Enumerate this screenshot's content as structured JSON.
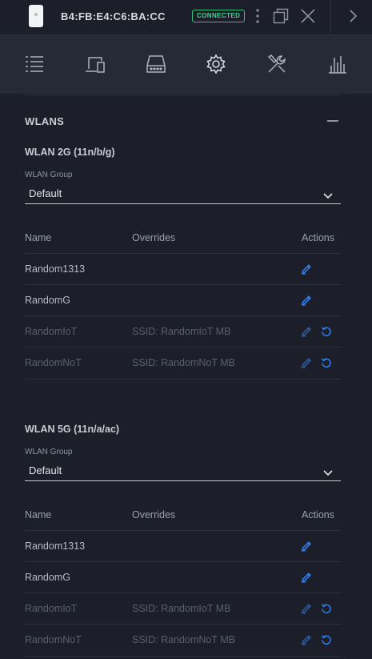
{
  "header": {
    "device_mac": "B4:FB:E4:C6:BA:CC",
    "status_badge": "CONNECTED",
    "status_color": "#32c27a"
  },
  "toolbar": {
    "tabs": [
      {
        "icon": "list-icon"
      },
      {
        "icon": "devices-icon"
      },
      {
        "icon": "storage-icon"
      },
      {
        "icon": "gear-icon"
      },
      {
        "icon": "tools-icon"
      },
      {
        "icon": "stats-icon"
      }
    ]
  },
  "section": {
    "title": "WLANS"
  },
  "bands": [
    {
      "title": "WLAN 2G (11n/b/g)",
      "group_label": "WLAN Group",
      "group_value": "Default",
      "columns": [
        "Name",
        "Overrides",
        "Actions"
      ],
      "rows": [
        {
          "name": "Random1313",
          "overrides": "",
          "enabled": true
        },
        {
          "name": "RandomG",
          "overrides": "",
          "enabled": true
        },
        {
          "name": "RandomIoT",
          "overrides": "SSID: RandomIoT MB",
          "enabled": false
        },
        {
          "name": "RandomNoT",
          "overrides": "SSID: RandomNoT MB",
          "enabled": false
        }
      ]
    },
    {
      "title": "WLAN 5G (11n/a/ac)",
      "group_label": "WLAN Group",
      "group_value": "Default",
      "columns": [
        "Name",
        "Overrides",
        "Actions"
      ],
      "rows": [
        {
          "name": "Random1313",
          "overrides": "",
          "enabled": true
        },
        {
          "name": "RandomG",
          "overrides": "",
          "enabled": true
        },
        {
          "name": "RandomIoT",
          "overrides": "SSID: RandomIoT MB",
          "enabled": false
        },
        {
          "name": "RandomNoT",
          "overrides": "SSID: RandomNoT MB",
          "enabled": false
        }
      ]
    }
  ],
  "colors": {
    "accent": "#2d7ff0",
    "accent_dim": "#2a5a9e"
  }
}
